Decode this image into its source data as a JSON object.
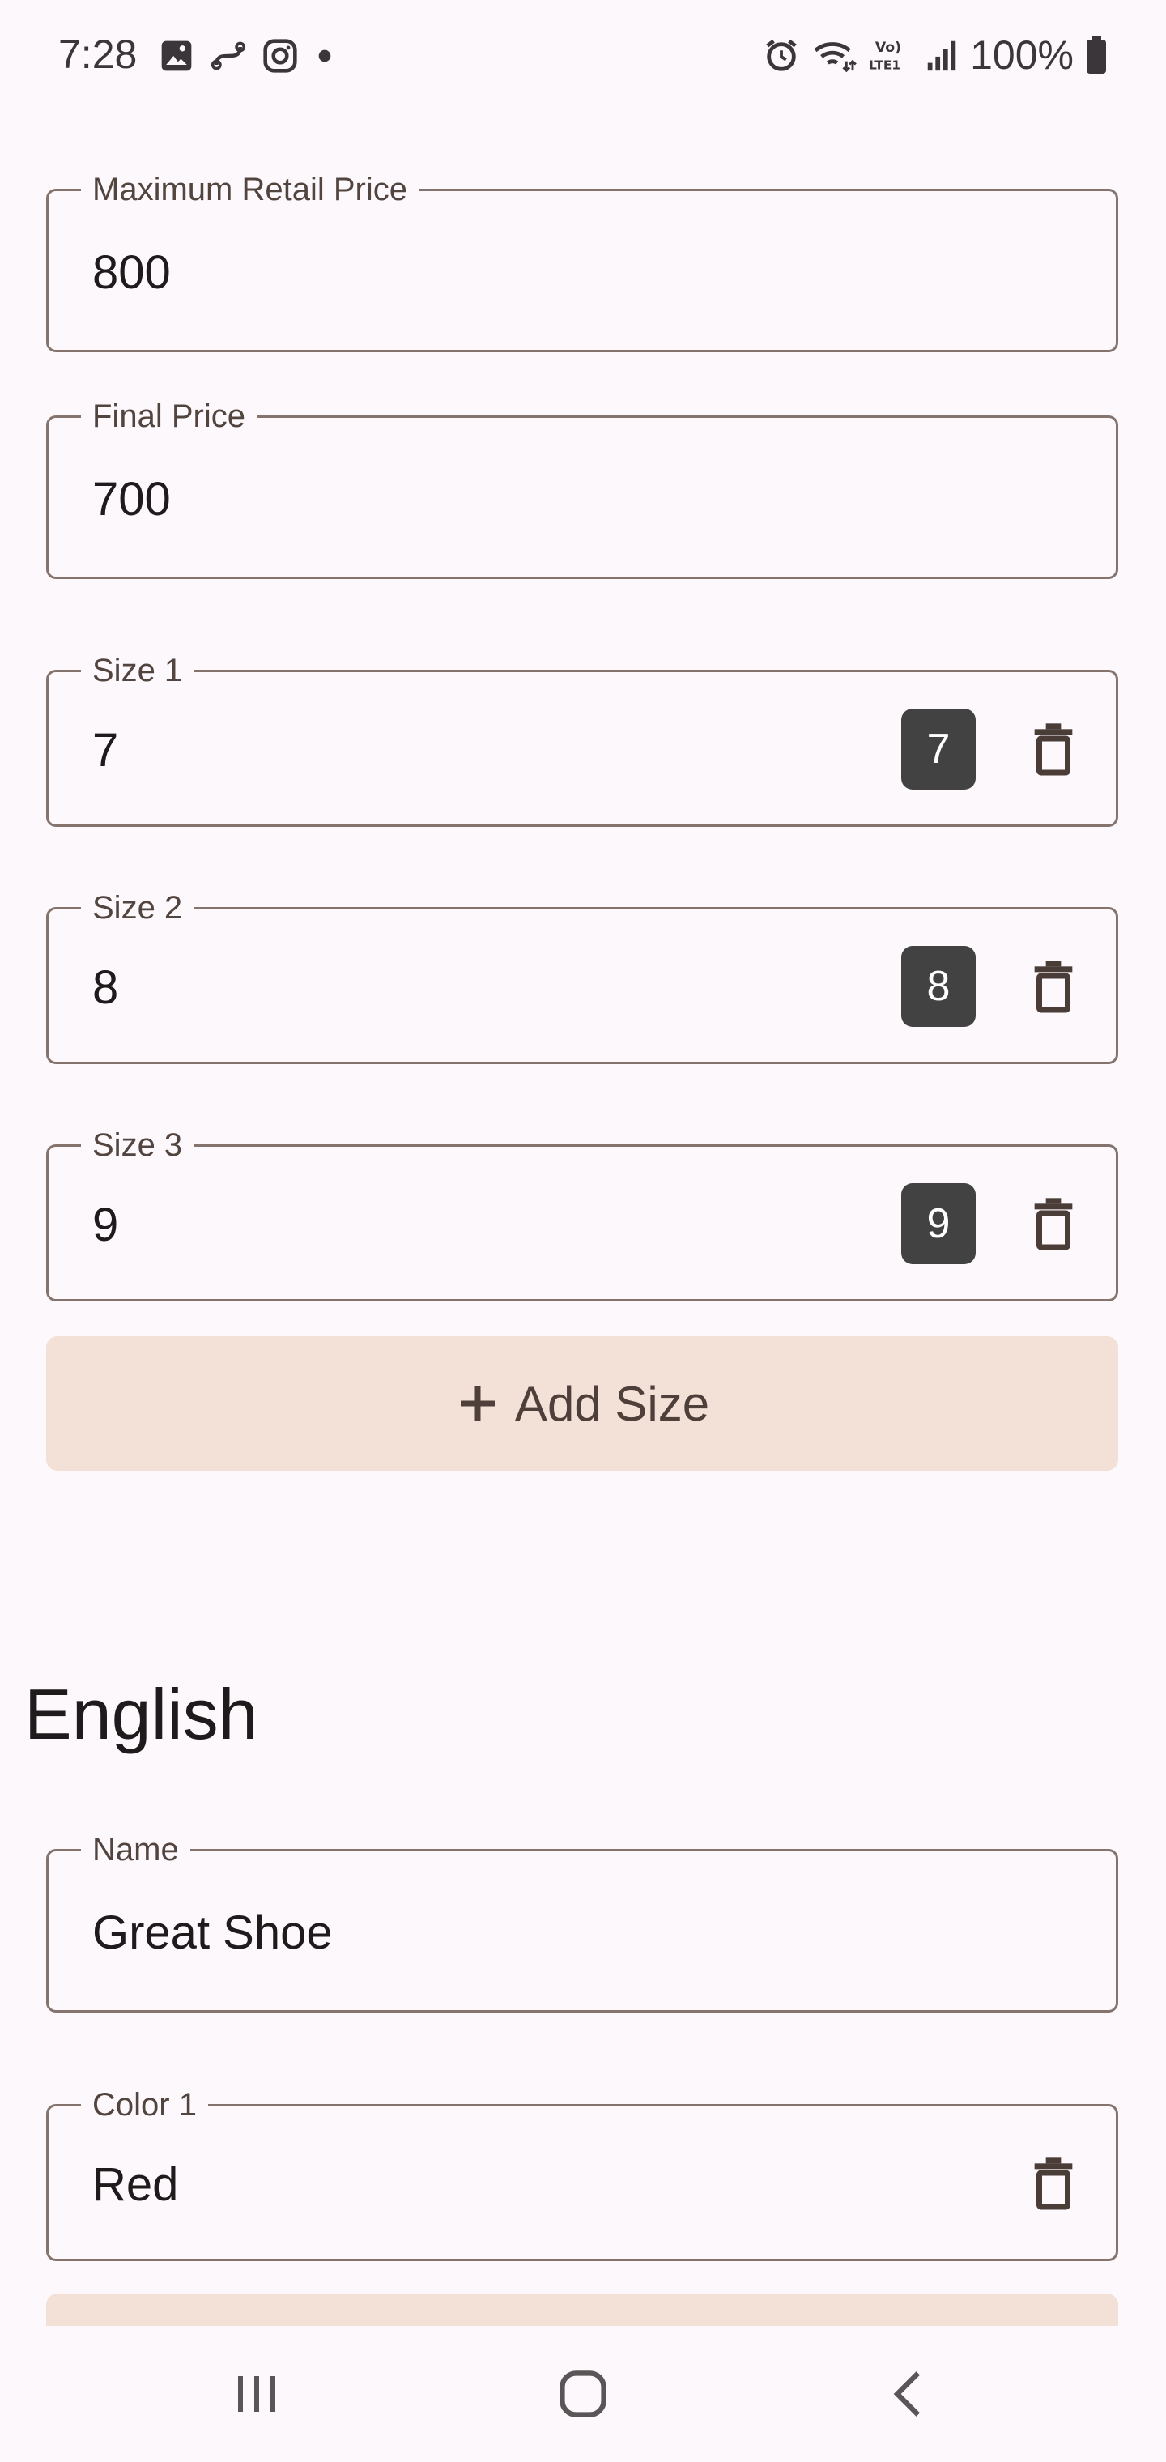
{
  "status_bar": {
    "time": "7:28",
    "battery": "100%",
    "left_icons": [
      "gallery-icon",
      "link-app-icon",
      "instagram-icon",
      "dot-icon"
    ],
    "right_icons": [
      "alarm-icon",
      "wifi-icon",
      "volte-icon",
      "signal-icon",
      "battery-icon"
    ]
  },
  "form": {
    "mrp": {
      "label": "Maximum Retail Price",
      "value": "800"
    },
    "final_price": {
      "label": "Final Price",
      "value": "700"
    },
    "sizes": [
      {
        "label": "Size 1",
        "value": "7",
        "chip": "7"
      },
      {
        "label": "Size 2",
        "value": "8",
        "chip": "8"
      },
      {
        "label": "Size 3",
        "value": "9",
        "chip": "9"
      }
    ],
    "add_size_label": "Add Size",
    "english_section_title": "English",
    "name": {
      "label": "Name",
      "value": "Great Shoe"
    },
    "color1": {
      "label": "Color 1",
      "value": "Red"
    }
  },
  "nav": {
    "recents": "recents-icon",
    "home": "home-icon",
    "back": "back-icon"
  },
  "colors": {
    "background": "#fdf8fb",
    "outline": "#85736e",
    "tonal_button": "#f3e0d6",
    "chip": "#424242"
  }
}
